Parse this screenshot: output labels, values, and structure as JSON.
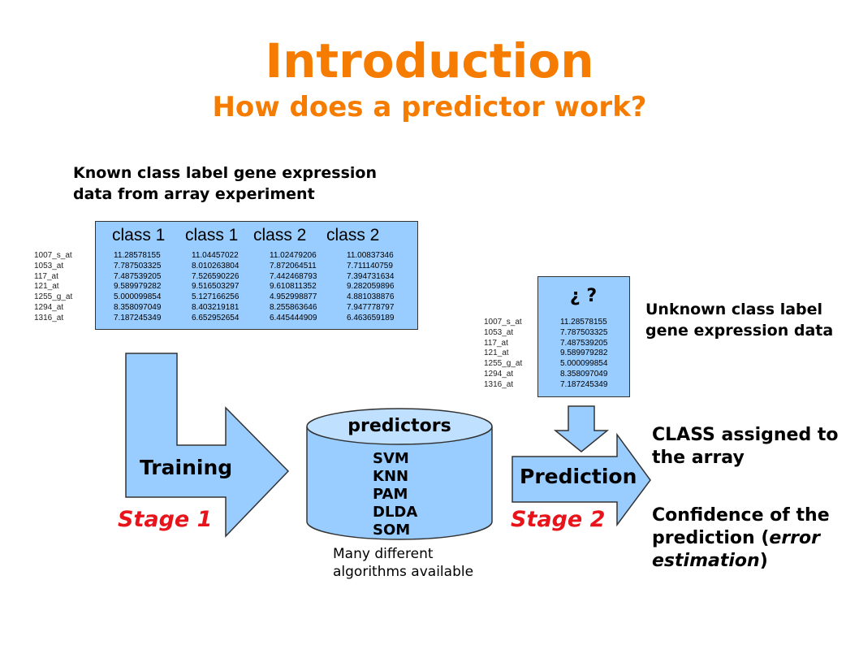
{
  "title": "Introduction",
  "subtitle": "How does a predictor work?",
  "known_label": "Known class label gene expression\ndata from array experiment",
  "training_table": {
    "headers": [
      "class 1",
      "class 1",
      "class 2",
      "class 2"
    ],
    "probes": [
      "1007_s_at",
      "1053_at",
      "117_at",
      "121_at",
      "1255_g_at",
      "1294_at",
      "1316_at"
    ],
    "columns": [
      [
        "11.28578155",
        "7.787503325",
        "7.487539205",
        "9.589979282",
        "5.000099854",
        "8.358097049",
        "7.187245349"
      ],
      [
        "11.04457022",
        "8.010263804",
        "7.526590226",
        "9.516503297",
        "5.127166256",
        "8.403219181",
        "6.652952654"
      ],
      [
        "11.02479206",
        "7.872064511",
        "7.442468793",
        "9.610811352",
        "4.952998877",
        "8.255863646",
        "6.445444909"
      ],
      [
        "11.00837346",
        "7.711140759",
        "7.394731634",
        "9.282059896",
        "4.881038876",
        "7.947778797",
        "6.463659189"
      ]
    ]
  },
  "unknown_label": "Unknown class label\ngene expression data",
  "unknown_table": {
    "header": "¿ ?",
    "probes": [
      "1007_s_at",
      "1053_at",
      "117_at",
      "121_at",
      "1255_g_at",
      "1294_at",
      "1316_at"
    ],
    "values": [
      "11.28578155",
      "7.787503325",
      "7.487539205",
      "9.589979282",
      "5.000099854",
      "8.358097049",
      "7.187245349"
    ]
  },
  "training": "Training",
  "stage1": "Stage 1",
  "predictors": {
    "title": "predictors",
    "algorithms": [
      "SVM",
      "KNN",
      "PAM",
      "DLDA",
      "SOM"
    ],
    "note": "Many different\nalgorithms available"
  },
  "prediction": "Prediction",
  "stage2": "Stage 2",
  "outputs": {
    "class_assigned": " CLASS assigned to\nthe array",
    "confidence_prefix": " Confidence of the\nprediction (",
    "confidence_italic": "error\nestimation",
    "confidence_suffix": ")"
  },
  "colors": {
    "orange": "#f57c00",
    "red": "#e8141b",
    "blue": "#99ccff"
  }
}
